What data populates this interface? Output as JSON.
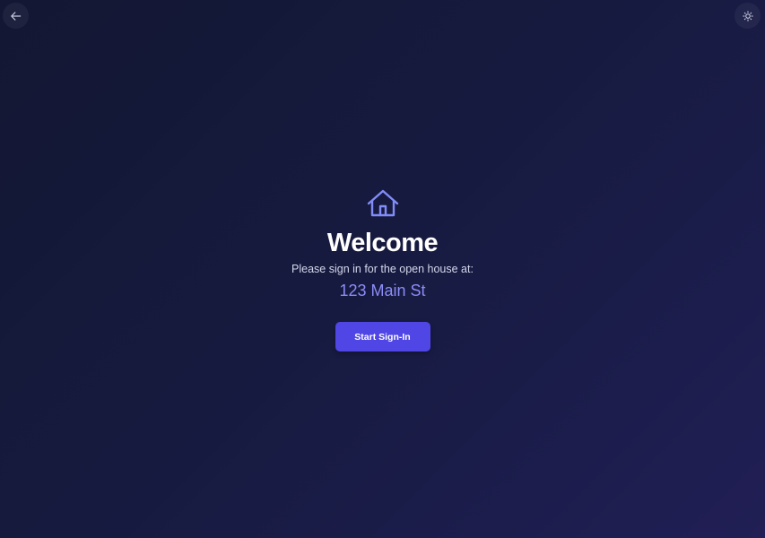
{
  "header": {
    "back_icon": "arrow-left-icon",
    "theme_icon": "sun-icon"
  },
  "main": {
    "icon": "house-icon",
    "title": "Welcome",
    "subtitle": "Please sign in for the open house at:",
    "address": "123 Main St",
    "start_button_label": "Start Sign-In"
  },
  "colors": {
    "accent": "#4f46e5",
    "address": "#8b8cf6",
    "icon": "#818cf8",
    "background_top": "#131733",
    "background_bottom": "#211f55"
  }
}
